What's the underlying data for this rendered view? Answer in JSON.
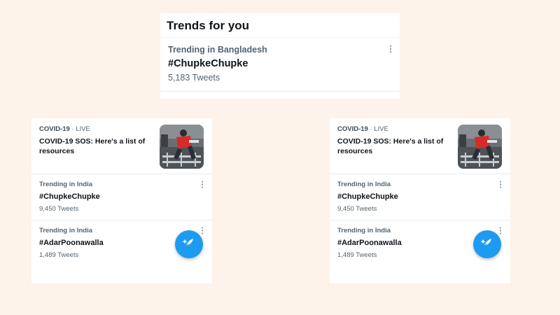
{
  "top_card": {
    "title": "Trends for you",
    "trend": {
      "context": "Trending in Bangladesh",
      "hashtag": "#ChupkeChupke",
      "count": "5,183 Tweets"
    }
  },
  "panels": [
    {
      "news": {
        "topic": "COVID-19",
        "separator": " · ",
        "status": "LIVE",
        "headline": "COVID-19 SOS: Here's a list of resources"
      },
      "trends": [
        {
          "context": "Trending in India",
          "hashtag": "#ChupkeChupke",
          "count": "9,450 Tweets"
        },
        {
          "context": "Trending in India",
          "hashtag": "#AdarPoonawalla",
          "count": "1,489 Tweets"
        }
      ]
    },
    {
      "news": {
        "topic": "COVID-19",
        "separator": " · ",
        "status": "LIVE",
        "headline": "COVID-19 SOS: Here's a list of resources"
      },
      "trends": [
        {
          "context": "Trending in India",
          "hashtag": "#ChupkeChupke",
          "count": "9,450 Tweets"
        },
        {
          "context": "Trending in India",
          "hashtag": "#AdarPoonawalla",
          "count": "1,489 Tweets"
        }
      ]
    }
  ],
  "icons": {
    "more": "more-vertical-icon",
    "compose": "compose-tweet-icon",
    "thumbnail": "news-thumbnail-image"
  },
  "colors": {
    "background": "#fdf3ea",
    "accent": "#1d9bf0",
    "text_primary": "#0f1419",
    "text_secondary": "#536471"
  }
}
